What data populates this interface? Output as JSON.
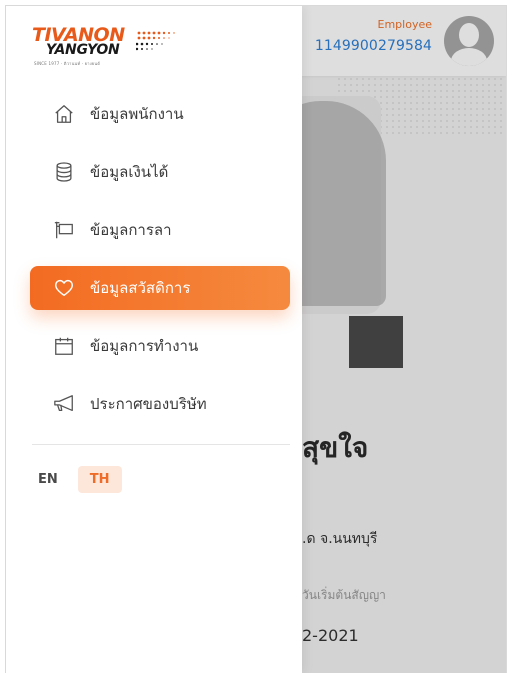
{
  "header": {
    "role": "Employee",
    "employee_id": "1149900279584"
  },
  "logo": {
    "line1": "TIVANON",
    "line2": "YANGYON",
    "since": "SINCE 1977 · ติวานนท์ · ยางยนต์"
  },
  "menu": {
    "items": [
      {
        "label": "ข้อมูลพนักงาน",
        "icon": "home-icon",
        "active": false
      },
      {
        "label": "ข้อมูลเงินได้",
        "icon": "database-icon",
        "active": false
      },
      {
        "label": "ข้อมูลการลา",
        "icon": "sign-icon",
        "active": false
      },
      {
        "label": "ข้อมูลสวัสดิการ",
        "icon": "heart-icon",
        "active": true
      },
      {
        "label": "ข้อมูลการทำงาน",
        "icon": "calendar-icon",
        "active": false
      },
      {
        "label": "ประกาศของบริษัท",
        "icon": "megaphone-icon",
        "active": false
      }
    ]
  },
  "language": {
    "options": [
      "EN",
      "TH"
    ],
    "selected": "TH"
  },
  "background": {
    "name_partial": "สุขใจ",
    "location_partial": ".ด จ.นนทบุรี",
    "contract_label_partial": "วันเริ่มต้นสัญญา",
    "contract_date_partial": "2-2021"
  },
  "colors": {
    "accent": "#f36b22",
    "accent_light": "#fde7db",
    "link_blue": "#2f80d8"
  }
}
